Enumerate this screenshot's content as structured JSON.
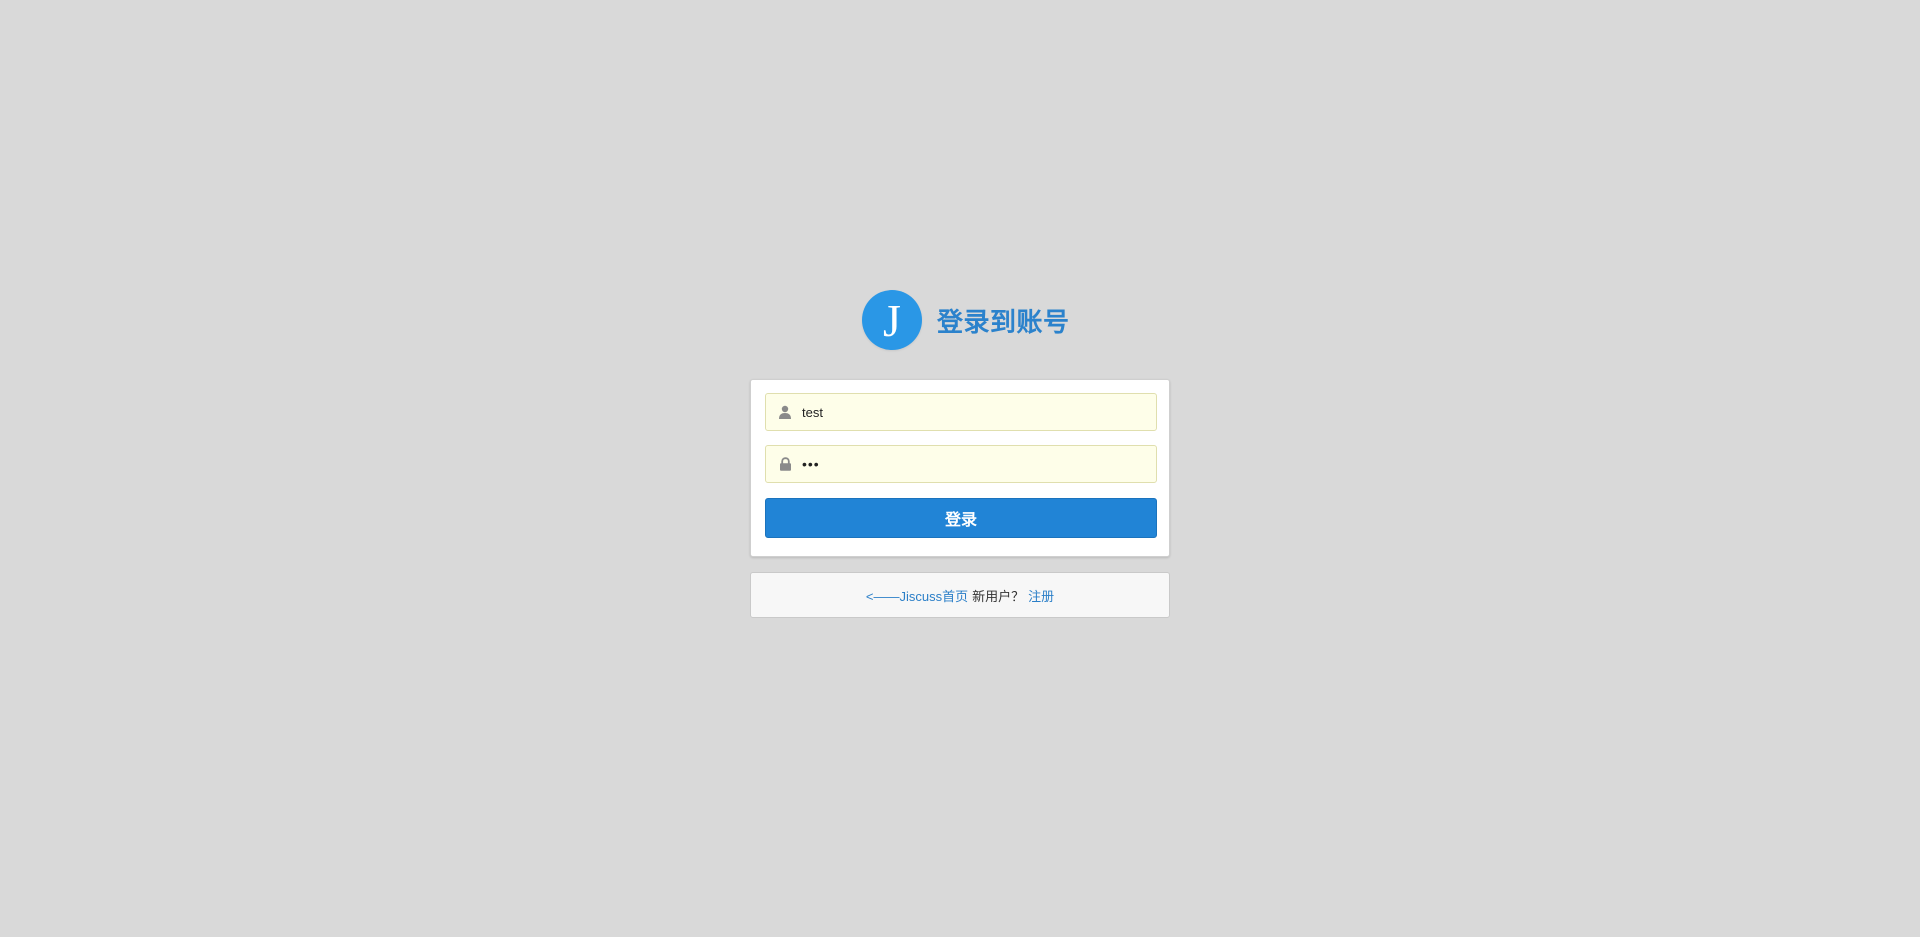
{
  "header": {
    "logo_letter": "J",
    "title": "登录到账号"
  },
  "form": {
    "username": {
      "value": "test",
      "icon": "user-icon"
    },
    "password": {
      "value": "abc",
      "icon": "lock-icon"
    },
    "submit_label": "登录"
  },
  "footer": {
    "home_link": "<——Jiscuss首页",
    "new_user_text": "新用户？",
    "register_link": "注册"
  },
  "colors": {
    "background": "#d9d9d9",
    "accent": "#2184d6",
    "logo": "#2a97e6",
    "title": "#2b82cc",
    "autofill": "#fefee9"
  }
}
